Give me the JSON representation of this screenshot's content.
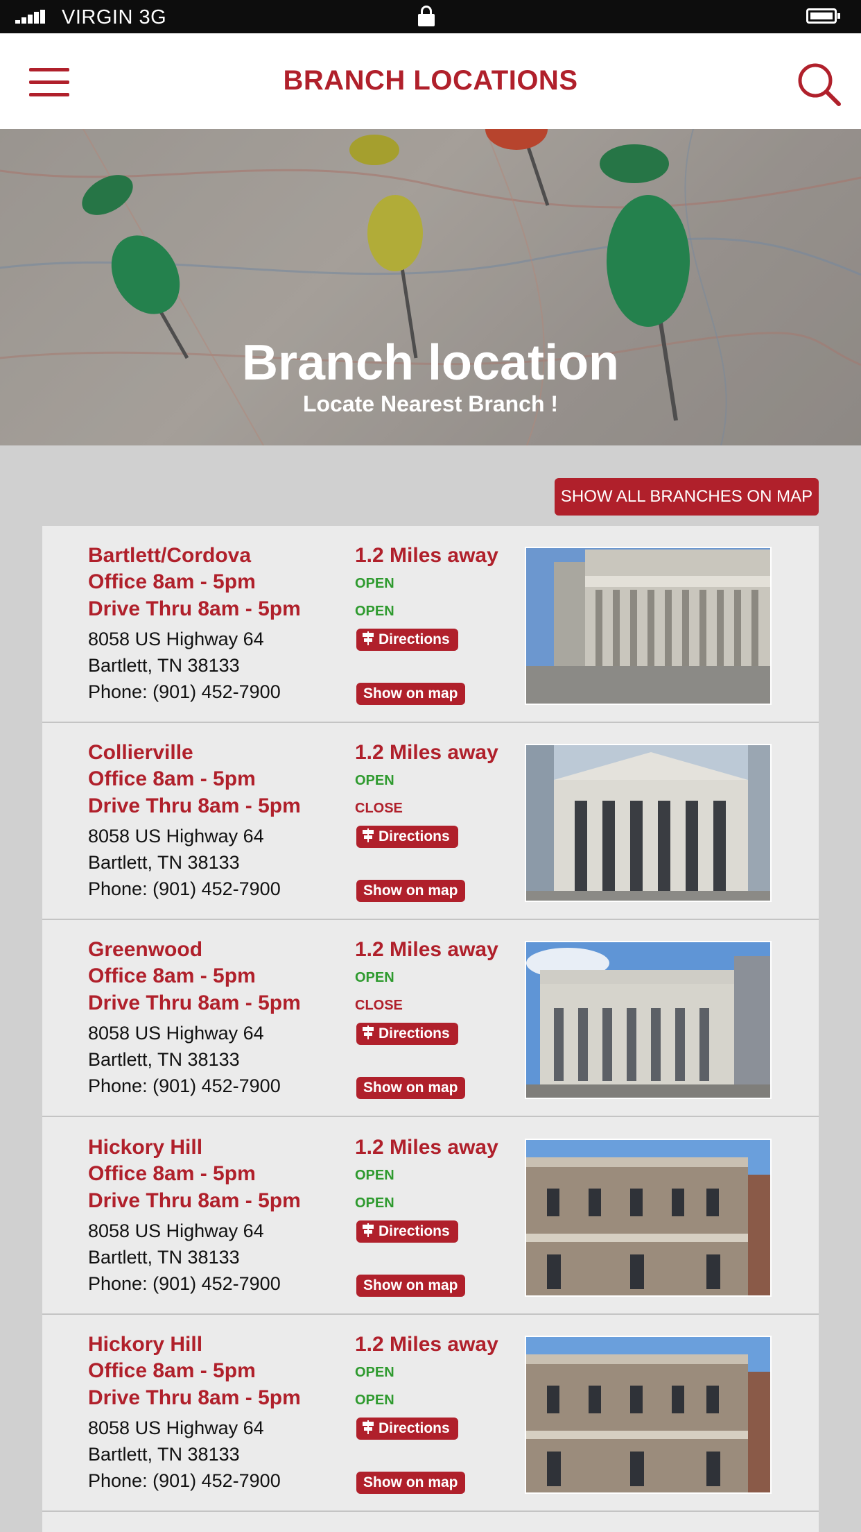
{
  "status_bar": {
    "carrier": "VIRGIN 3G",
    "icons": [
      "signal-icon",
      "lock-icon",
      "battery-icon"
    ]
  },
  "navbar": {
    "title": "BRANCH LOCATIONS",
    "menu_icon": "hamburger-menu-icon",
    "search_icon": "search-icon"
  },
  "hero": {
    "title": "Branch location",
    "subtitle": "Locate Nearest Branch !"
  },
  "actions": {
    "show_all_label": "SHOW ALL BRANCHES ON MAP"
  },
  "colors": {
    "brand": "#b0202b",
    "open": "#2e9a2e",
    "background": "#d0d0d0",
    "card": "#ebebeb"
  },
  "branches": [
    {
      "name": "Bartlett/Cordova",
      "office": "Office 8am - 5pm",
      "drive": "Drive Thru 8am - 5pm",
      "address1": "8058 US Highway 64",
      "address2": "Bartlett, TN 38133",
      "phone": "Phone: (901) 452-7900",
      "distance": "1.2 Miles away",
      "office_status": "OPEN",
      "drive_status": "OPEN",
      "directions_label": "Directions",
      "map_label": "Show on map"
    },
    {
      "name": "Collierville",
      "office": "Office 8am - 5pm",
      "drive": "Drive Thru 8am - 5pm",
      "address1": "8058 US Highway 64",
      "address2": "Bartlett, TN 38133",
      "phone": "Phone: (901) 452-7900",
      "distance": "1.2 Miles away",
      "office_status": "OPEN",
      "drive_status": "CLOSE",
      "directions_label": "Directions",
      "map_label": "Show on map"
    },
    {
      "name": "Greenwood",
      "office": "Office 8am - 5pm",
      "drive": "Drive Thru 8am - 5pm",
      "address1": "8058 US Highway 64",
      "address2": "Bartlett, TN 38133",
      "phone": "Phone: (901) 452-7900",
      "distance": "1.2 Miles away",
      "office_status": "OPEN",
      "drive_status": "CLOSE",
      "directions_label": "Directions",
      "map_label": "Show on map"
    },
    {
      "name": "Hickory Hill",
      "office": "Office 8am - 5pm",
      "drive": "Drive Thru 8am - 5pm",
      "address1": "8058 US Highway 64",
      "address2": "Bartlett, TN 38133",
      "phone": "Phone: (901) 452-7900",
      "distance": "1.2 Miles away",
      "office_status": "OPEN",
      "drive_status": "OPEN",
      "directions_label": "Directions",
      "map_label": "Show on map"
    },
    {
      "name": "Hickory Hill",
      "office": "Office 8am - 5pm",
      "drive": "Drive Thru 8am - 5pm",
      "address1": "8058 US Highway 64",
      "address2": "Bartlett, TN 38133",
      "phone": "Phone: (901) 452-7900",
      "distance": "1.2 Miles away",
      "office_status": "OPEN",
      "drive_status": "OPEN",
      "directions_label": "Directions",
      "map_label": "Show on map"
    }
  ]
}
